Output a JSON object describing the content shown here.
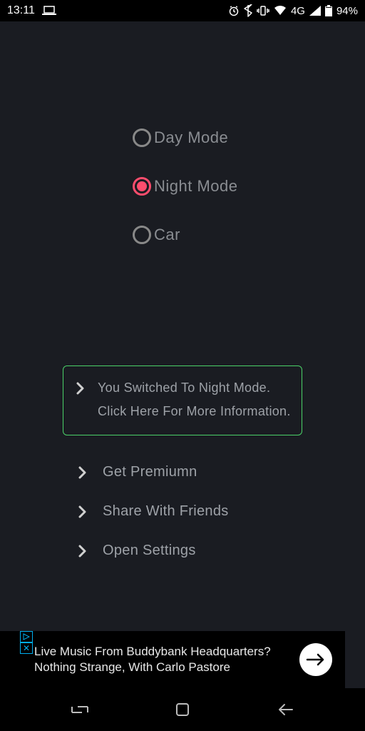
{
  "status": {
    "time": "13:11",
    "network": "4G",
    "battery": "94%"
  },
  "radios": {
    "day": "Day Mode",
    "night": "Night Mode",
    "car": "Car"
  },
  "info": {
    "line1": "You Switched To Night Mode.",
    "line2": "Click Here For More Information."
  },
  "actions": {
    "premium": "Get Premiumn",
    "share": "Share With Friends",
    "settings": "Open Settings"
  },
  "ad": {
    "line1": "Live Music From Buddybank Headquarters?",
    "line2": "Nothing Strange, With Carlo Pastore"
  }
}
